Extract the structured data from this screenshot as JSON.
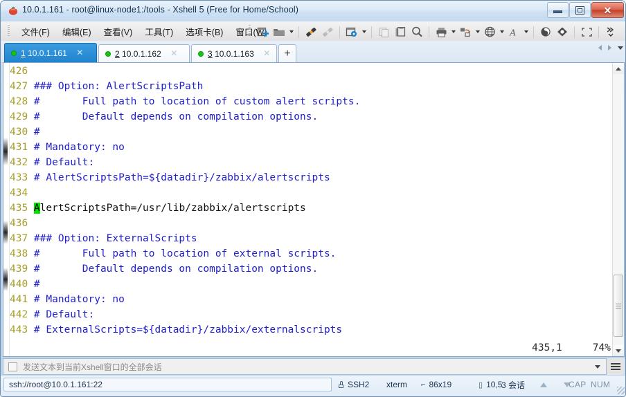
{
  "window": {
    "title": "10.0.1.161 - root@linux-node1:/tools - Xshell 5 (Free for Home/School)",
    "app_icon": "xshell-icon",
    "minimize_label": "最小化",
    "maximize_label": "最大化",
    "close_label": "关闭"
  },
  "menubar": {
    "items": [
      {
        "text": "文件(F)",
        "key": "F"
      },
      {
        "text": "编辑(E)",
        "key": "E"
      },
      {
        "text": "查看(V)",
        "key": "V"
      },
      {
        "text": "工具(T)",
        "key": "T"
      },
      {
        "text": "选项卡(B)",
        "key": "B"
      },
      {
        "text": "窗口(W)",
        "key": "W"
      }
    ]
  },
  "toolbar": {
    "buttons": [
      "new-session-icon",
      "open-session-folder-icon",
      "open-session-dropdown-icon",
      "connect-icon",
      "disconnect-icon",
      "session-properties-icon",
      "session-properties-dropdown-icon",
      "copy-icon",
      "paste-icon",
      "find-icon",
      "print-icon",
      "print-dropdown-icon",
      "transfer-file-icon",
      "transfer-file-dropdown-icon",
      "encoding-icon",
      "encoding-dropdown-icon",
      "font-icon",
      "font-dropdown-icon",
      "xftp-icon",
      "xshell-compose-icon",
      "fullscreen-icon",
      "toolbar-overflow-icon"
    ]
  },
  "tabs": {
    "items": [
      {
        "index": "1",
        "label": "10.0.1.161",
        "status": "connected",
        "active": true
      },
      {
        "index": "2",
        "label": "10.0.1.162",
        "status": "connected",
        "active": false
      },
      {
        "index": "3",
        "label": "10.0.1.163",
        "status": "connected",
        "active": false
      }
    ],
    "add_label": "+",
    "nav_prev": "scroll-tabs-left-icon",
    "nav_next": "scroll-tabs-right-icon",
    "nav_list": "tab-list-icon"
  },
  "terminal": {
    "lines": [
      {
        "no": "426",
        "parts": []
      },
      {
        "no": "427",
        "parts": [
          {
            "t": "### Option: AlertScriptsPath",
            "c": "cmt"
          }
        ]
      },
      {
        "no": "428",
        "parts": [
          {
            "t": "#       Full path to location of custom alert scripts.",
            "c": "cmt"
          }
        ]
      },
      {
        "no": "429",
        "parts": [
          {
            "t": "#       Default depends on compilation options.",
            "c": "cmt"
          }
        ]
      },
      {
        "no": "430",
        "parts": [
          {
            "t": "#",
            "c": "cmt"
          }
        ]
      },
      {
        "no": "431",
        "parts": [
          {
            "t": "# Mandatory: no",
            "c": "cmt"
          }
        ]
      },
      {
        "no": "432",
        "parts": [
          {
            "t": "# Default:",
            "c": "cmt"
          }
        ]
      },
      {
        "no": "433",
        "parts": [
          {
            "t": "# AlertScriptsPath=${datadir}/zabbix/alertscripts",
            "c": "cmt"
          }
        ]
      },
      {
        "no": "434",
        "parts": []
      },
      {
        "no": "435",
        "parts": [
          {
            "t": "A",
            "c": "cursor"
          },
          {
            "t": "lertScriptsPath=/usr/lib/zabbix/alertscripts",
            "c": "plain"
          }
        ]
      },
      {
        "no": "436",
        "parts": []
      },
      {
        "no": "437",
        "parts": [
          {
            "t": "### Option: ExternalScripts",
            "c": "cmt"
          }
        ]
      },
      {
        "no": "438",
        "parts": [
          {
            "t": "#       Full path to location of external scripts.",
            "c": "cmt"
          }
        ]
      },
      {
        "no": "439",
        "parts": [
          {
            "t": "#       Default depends on compilation options.",
            "c": "cmt"
          }
        ]
      },
      {
        "no": "440",
        "parts": [
          {
            "t": "#",
            "c": "cmt"
          }
        ]
      },
      {
        "no": "441",
        "parts": [
          {
            "t": "# Mandatory: no",
            "c": "cmt"
          }
        ]
      },
      {
        "no": "442",
        "parts": [
          {
            "t": "# Default:",
            "c": "cmt"
          }
        ]
      },
      {
        "no": "443",
        "parts": [
          {
            "t": "# ExternalScripts=${datadir}/zabbix/externalscripts",
            "c": "cmt"
          }
        ]
      }
    ],
    "editor_position": "435,1",
    "editor_percent": "74%",
    "colors": {
      "line_number": "#a8a02a",
      "comment": "#2020d0",
      "text": "#101010",
      "cursor_bg": "#00e400",
      "background": "#ffffff"
    }
  },
  "sendbar": {
    "checkbox_checked": false,
    "placeholder": "发送文本到当前Xshell窗口的全部会话",
    "dropdown_icon": "chevron-down-icon",
    "menu_icon": "hamburger-menu-icon"
  },
  "statusbar": {
    "url": "ssh://root@10.0.1.161:22",
    "protocol": "SSH2",
    "protocol_icon": "lock-icon",
    "terminal_type": "xterm",
    "size": "86x19",
    "size_icon": "resize-icon",
    "cursor": "10,5",
    "cursor_icon": "cursor-position-icon",
    "sessions": "3 会话",
    "upload_icon": "upload-arrow-icon",
    "download_icon": "download-arrow-icon",
    "caps": "CAP",
    "num": "NUM",
    "resize_grip": "resize-grip-icon"
  }
}
